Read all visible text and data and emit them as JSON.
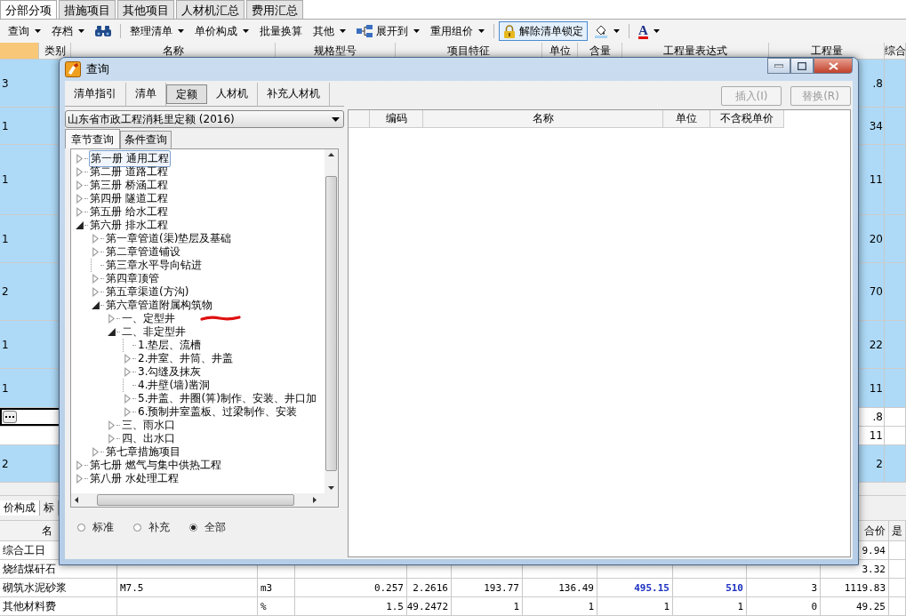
{
  "app_tabs": [
    {
      "label": "分部分项",
      "selected": true
    },
    {
      "label": "措施项目",
      "selected": false
    },
    {
      "label": "其他项目",
      "selected": false
    },
    {
      "label": "人材机汇总",
      "selected": false
    },
    {
      "label": "费用汇总",
      "selected": false
    }
  ],
  "toolbar": [
    [
      {
        "kind": "menu",
        "label": "查询"
      },
      {
        "kind": "menu",
        "label": "存档"
      },
      {
        "kind": "find"
      }
    ],
    [
      {
        "kind": "menu",
        "label": "整理清单"
      },
      {
        "kind": "menu",
        "label": "单价构成"
      },
      {
        "kind": "button",
        "label": "批量换算"
      },
      {
        "kind": "menu",
        "label": "其他"
      },
      {
        "kind": "tree_menu",
        "label": "展开到"
      },
      {
        "kind": "menu",
        "label": "重用组价"
      }
    ],
    [
      {
        "kind": "lock",
        "label": "解除清单锁定",
        "on": true
      },
      {
        "kind": "fill"
      }
    ],
    [
      {
        "kind": "font_color",
        "label": "A"
      }
    ]
  ],
  "grid": {
    "columns": [
      "类别",
      "名称",
      "规格型号",
      "项目特征",
      "单位",
      "含量",
      "工程量表达式",
      "工程量",
      "综合"
    ],
    "rows": [
      {
        "column_1": "3",
        "quantity": ".8",
        "selected": true,
        "editing": false
      },
      {
        "column_1": "1",
        "quantity": "34",
        "selected": true,
        "editing": false
      },
      {
        "column_1": "1",
        "quantity": "11",
        "selected": true,
        "editing": false
      },
      {
        "column_1": "1",
        "quantity": "20",
        "selected": true,
        "editing": false
      },
      {
        "column_1": "2",
        "quantity": "70",
        "selected": true,
        "editing": false
      },
      {
        "column_1": "1",
        "quantity": "22",
        "selected": true,
        "editing": false
      },
      {
        "column_1": "1",
        "quantity": "11",
        "selected": true,
        "editing": false
      },
      {
        "quantity": ".8",
        "selected": false,
        "editing": true
      },
      {
        "quantity": "11",
        "selected": false,
        "editing": false
      },
      {
        "column_1": "2",
        "quantity": "2",
        "selected": true,
        "editing": false
      }
    ]
  },
  "detail_tabs": [
    {
      "label": "价构成",
      "selected": true
    },
    {
      "label": "标",
      "selected": false
    }
  ],
  "detail_table": {
    "columns": {
      "name": "名",
      "total": "合价",
      "column_12": "是"
    },
    "rows": [
      {
        "name": "综合工日",
        "total": "9.94"
      },
      {
        "name": "烧结煤矸石",
        "total": "3.32"
      },
      {
        "name": "砌筑水泥砂浆",
        "spec": "M7.5",
        "unit": "m3",
        "values": [
          {
            "text": "0.257",
            "modified": false
          },
          {
            "text": "2.2616",
            "modified": false
          },
          {
            "text": "193.77",
            "modified": false
          },
          {
            "text": "136.49",
            "modified": false
          },
          {
            "text": "495.15",
            "modified": true
          },
          {
            "text": "510",
            "modified": true
          },
          {
            "text": "3",
            "modified": false
          }
        ],
        "total": "1119.83"
      },
      {
        "name": "其他材料费",
        "unit": "%",
        "values": [
          {
            "text": "1.5",
            "modified": false
          },
          {
            "text": "49.2472",
            "modified": false
          },
          {
            "text": "1",
            "modified": false
          },
          {
            "text": "1",
            "modified": false
          },
          {
            "text": "1",
            "modified": false
          },
          {
            "text": "1",
            "modified": false
          },
          {
            "text": "0",
            "modified": false
          }
        ],
        "total": "49.25"
      }
    ]
  },
  "dialog": {
    "title": "查询",
    "tabs": [
      {
        "label": "清单指引",
        "selected": false
      },
      {
        "label": "清单",
        "selected": false
      },
      {
        "label": "定额",
        "selected": true
      },
      {
        "label": "人材机",
        "selected": false
      },
      {
        "label": "补充人材机",
        "selected": false
      }
    ],
    "source": "山东省市政工程消耗里定额 (2016)",
    "search_tabs": [
      {
        "label": "章节查询",
        "selected": true
      },
      {
        "label": "条件查询",
        "selected": false
      }
    ],
    "tree": [
      {
        "label": "第一册 通用工程",
        "kind": "folder",
        "expanded": false,
        "selected": true
      },
      {
        "label": "第二册 道路工程",
        "kind": "folder",
        "expanded": false,
        "selected": false
      },
      {
        "label": "第三册 桥涵工程",
        "kind": "folder",
        "expanded": false,
        "selected": false
      },
      {
        "label": "第四册 隧道工程",
        "kind": "folder",
        "expanded": false,
        "selected": false
      },
      {
        "label": "第五册 给水工程",
        "kind": "folder",
        "expanded": false,
        "selected": false
      },
      {
        "label": "第六册 排水工程",
        "kind": "folder",
        "expanded": true,
        "selected": false,
        "children": [
          {
            "label": "第一章管道(渠)垫层及基础",
            "kind": "folder",
            "expanded": false,
            "selected": false
          },
          {
            "label": "第二章管道铺设",
            "kind": "folder",
            "expanded": false,
            "selected": false
          },
          {
            "label": "第三章水平导向钻进",
            "kind": "leaf",
            "selected": false
          },
          {
            "label": "第四章顶管",
            "kind": "folder",
            "expanded": false,
            "selected": false
          },
          {
            "label": "第五章渠道(方沟)",
            "kind": "folder",
            "expanded": false,
            "selected": false
          },
          {
            "label": "第六章管道附属构筑物",
            "kind": "folder",
            "expanded": true,
            "selected": false,
            "children": [
              {
                "label": "一、定型井",
                "kind": "folder",
                "expanded": false,
                "selected": false
              },
              {
                "label": "二、非定型井",
                "kind": "folder",
                "expanded": true,
                "selected": false,
                "children": [
                  {
                    "label": "1.垫层、流槽",
                    "kind": "leaf",
                    "selected": false
                  },
                  {
                    "label": "2.井室、井筒、井盖",
                    "kind": "folder",
                    "expanded": false,
                    "selected": false
                  },
                  {
                    "label": "3.勾缝及抹灰",
                    "kind": "folder",
                    "expanded": false,
                    "selected": false
                  },
                  {
                    "label": "4.井壁(墙)凿洞",
                    "kind": "leaf",
                    "selected": false
                  },
                  {
                    "label": "5.井盖、井圈(箅)制作、安装、井口加",
                    "kind": "folder",
                    "expanded": false,
                    "selected": false
                  },
                  {
                    "label": "6.预制井室盖板、过梁制作、安装",
                    "kind": "folder",
                    "expanded": false,
                    "selected": false
                  }
                ]
              },
              {
                "label": "三、雨水口",
                "kind": "folder",
                "expanded": false,
                "selected": false
              },
              {
                "label": "四、出水口",
                "kind": "folder",
                "expanded": false,
                "selected": false
              }
            ]
          },
          {
            "label": "第七章措施项目",
            "kind": "folder",
            "expanded": false,
            "selected": false
          }
        ]
      },
      {
        "label": "第七册 燃气与集中供热工程",
        "kind": "folder",
        "expanded": false,
        "selected": false
      },
      {
        "label": "第八册 水处理工程",
        "kind": "folder",
        "expanded": false,
        "selected": false
      }
    ],
    "filters": [
      {
        "label": "标准",
        "selected": false
      },
      {
        "label": "补充",
        "selected": false
      },
      {
        "label": "全部",
        "selected": true
      }
    ],
    "actions": [
      {
        "label": "插入(I)",
        "disabled": true
      },
      {
        "label": "替换(R)",
        "disabled": true
      }
    ],
    "columns": [
      "编码",
      "名称",
      "单位",
      "不含税单价"
    ]
  }
}
